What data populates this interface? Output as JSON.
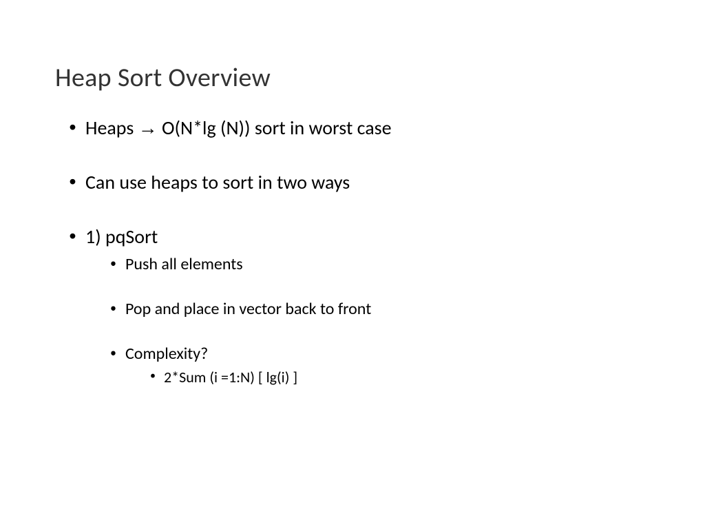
{
  "slide": {
    "title": "Heap Sort Overview",
    "bullets_l1": {
      "b1_pre": "Heaps ",
      "b1_arrow": "→",
      "b1_post": " O(N*lg (N)) sort in worst case",
      "b2": "Can use heaps to sort in two ways",
      "b3": "1) pqSort"
    },
    "bullets_l2": {
      "s1": "Push all elements",
      "s2": "Pop and place in vector back to front",
      "s3": "Complexity?"
    },
    "bullets_l3": {
      "t1": "2*Sum (i =1:N) [ lg(i) ]"
    }
  }
}
